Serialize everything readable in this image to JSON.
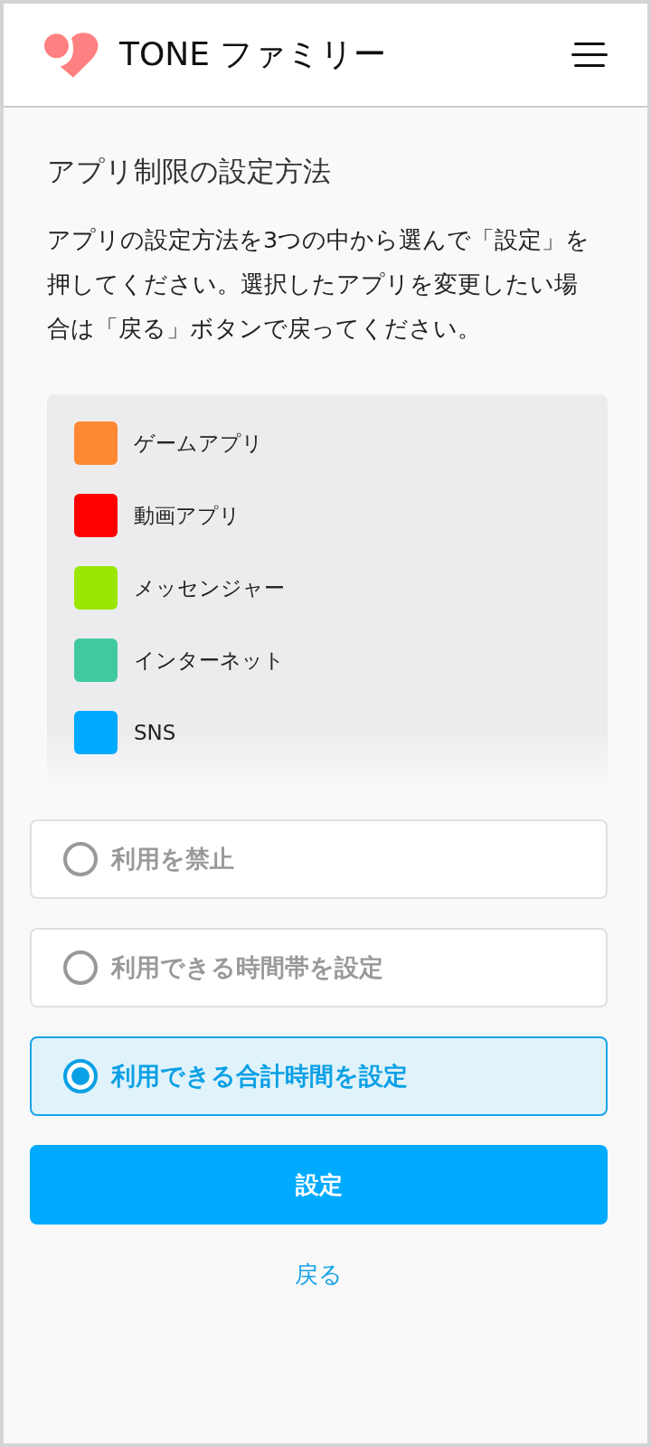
{
  "header": {
    "title": "TONE ファミリー"
  },
  "page_title": "アプリ制限の設定方法",
  "description": "アプリの設定方法を3つの中から選んで「設定」を押してください。選択したアプリを変更したい場合は「戻る」ボタンで戻ってください。",
  "apps": [
    {
      "label": "ゲームアプリ",
      "color": "#ff8833"
    },
    {
      "label": "動画アプリ",
      "color": "#ff0000"
    },
    {
      "label": "メッセンジャー",
      "color": "#99e600"
    },
    {
      "label": "インターネット",
      "color": "#40c9a0"
    },
    {
      "label": "SNS",
      "color": "#00aaff"
    }
  ],
  "options": [
    {
      "label": "利用を禁止",
      "selected": false
    },
    {
      "label": "利用できる時間帯を設定",
      "selected": false
    },
    {
      "label": "利用できる合計時間を設定",
      "selected": true
    }
  ],
  "submit_button": "設定",
  "back_link": "戻る"
}
